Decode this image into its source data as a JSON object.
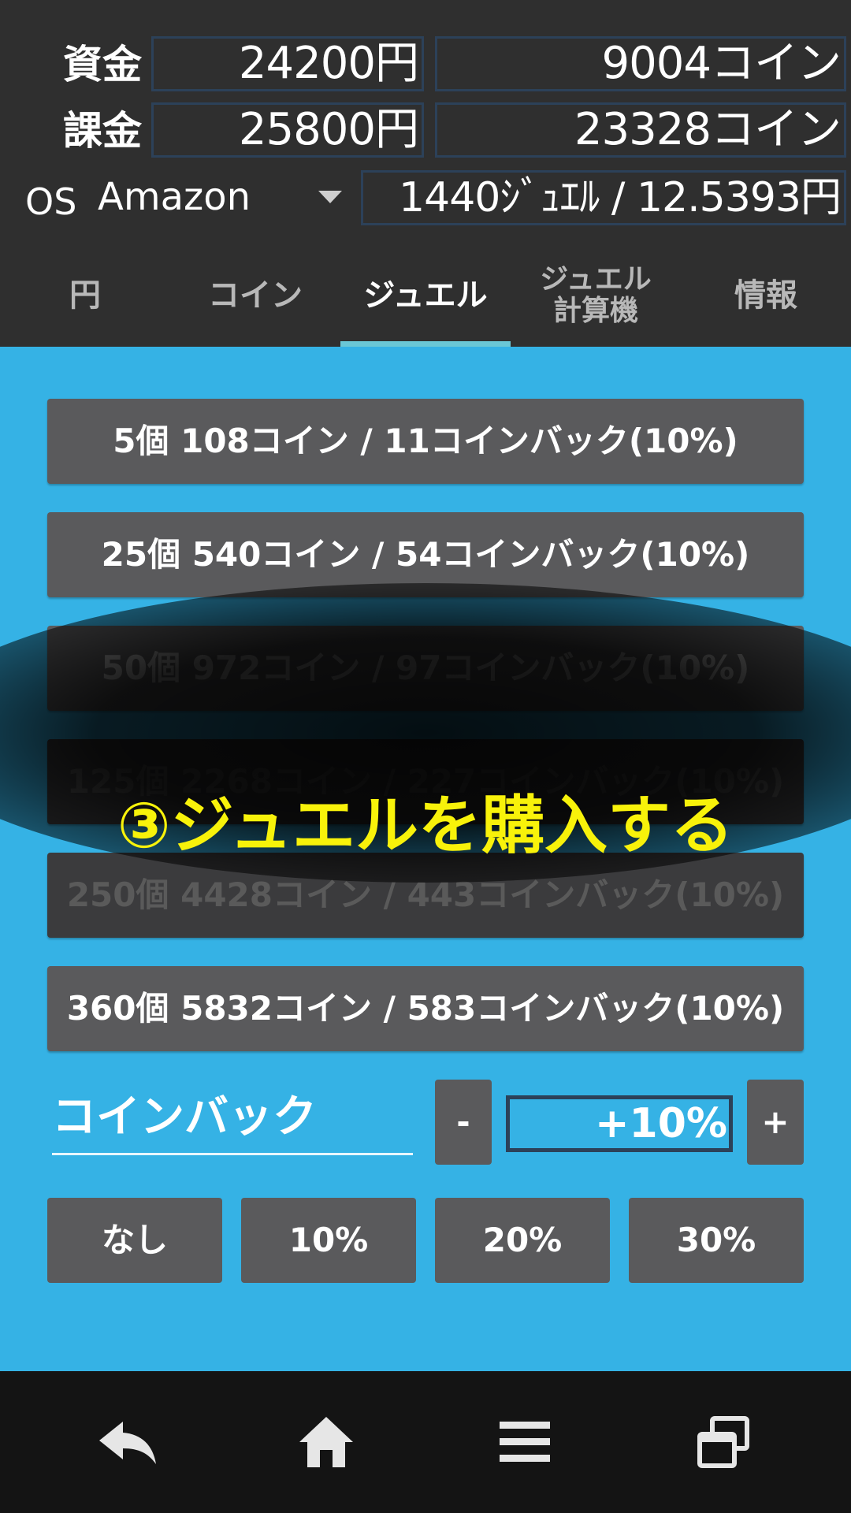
{
  "header": {
    "funds_label": "資金",
    "funds_yen": "24200円",
    "funds_coin": "9004コイン",
    "charge_label": "課金",
    "charge_yen": "25800円",
    "charge_coin": "23328コイン",
    "os_label": "OS",
    "os_value": "Amazon",
    "rate": "1440ｼﾞｭｴﾙ / 12.5393円"
  },
  "tabs": [
    {
      "label": "円"
    },
    {
      "label": "コイン"
    },
    {
      "label": "ジュエル",
      "active": true
    },
    {
      "label": "ジュエル\n計算機"
    },
    {
      "label": "情報"
    }
  ],
  "packages": [
    {
      "label": "5個 108コイン / 11コインバック(10%)"
    },
    {
      "label": "25個 540コイン / 54コインバック(10%)"
    },
    {
      "label": "50個 972コイン / 97コインバック(10%)"
    },
    {
      "label": "125個 2268コイン / 227コインバック(10%)"
    },
    {
      "label": "250個 4428コイン / 443コインバック(10%)"
    },
    {
      "label": "360個 5832コイン / 583コインバック(10%)"
    }
  ],
  "overlay_caption": "③ジュエルを購入する",
  "coinback": {
    "label": "コインバック",
    "minus": "-",
    "value": "+10%",
    "plus": "+",
    "presets": [
      "なし",
      "10%",
      "20%",
      "30%"
    ]
  },
  "colors": {
    "header_bg": "#2f2f2f",
    "main_bg": "#35b2e5",
    "button_bg": "#5a5a5c",
    "tab_indicator": "#6ac7d6",
    "caption": "#f8f20a",
    "navbar_bg": "#141414"
  },
  "icons": {
    "nav_back": "back-arrow-icon",
    "nav_home": "home-icon",
    "nav_menu": "menu-icon",
    "nav_recents": "recent-apps-icon"
  }
}
